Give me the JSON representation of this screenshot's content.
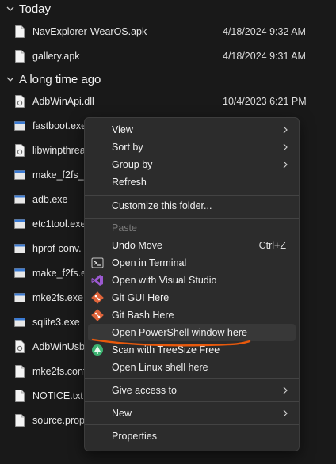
{
  "groups": {
    "today": {
      "title": "Today",
      "files": [
        {
          "name": "NavExplorer-WearOS.apk",
          "date": "4/18/2024 9:32 AM",
          "icon": "document-icon"
        },
        {
          "name": "gallery.apk",
          "date": "4/18/2024 9:31 AM",
          "icon": "document-icon"
        }
      ]
    },
    "long_ago": {
      "title": "A long time ago",
      "files": [
        {
          "name": "AdbWinApi.dll",
          "date": "10/4/2023 6:21 PM",
          "icon": "dll-icon"
        },
        {
          "name": "fastboot.exe",
          "icon": "exe-icon"
        },
        {
          "name": "libwinpthrea",
          "icon": "dll-icon"
        },
        {
          "name": "make_f2fs_c",
          "icon": "exe-icon"
        },
        {
          "name": "adb.exe",
          "icon": "exe-icon"
        },
        {
          "name": "etc1tool.exe",
          "icon": "exe-icon"
        },
        {
          "name": "hprof-conv.",
          "icon": "exe-icon"
        },
        {
          "name": "make_f2fs.e",
          "icon": "exe-icon"
        },
        {
          "name": "mke2fs.exe",
          "icon": "exe-icon"
        },
        {
          "name": "sqlite3.exe",
          "icon": "exe-icon"
        },
        {
          "name": "AdbWinUsb",
          "icon": "dll-icon"
        },
        {
          "name": "mke2fs.conf",
          "icon": "document-icon"
        },
        {
          "name": "NOTICE.txt",
          "icon": "document-icon"
        },
        {
          "name": "source.prop",
          "icon": "document-icon"
        }
      ]
    }
  },
  "context_menu": {
    "view": "View",
    "sort_by": "Sort by",
    "group_by": "Group by",
    "refresh": "Refresh",
    "customize": "Customize this folder...",
    "paste": "Paste",
    "undo_move": "Undo Move",
    "undo_shortcut": "Ctrl+Z",
    "open_terminal": "Open in Terminal",
    "open_vs": "Open with Visual Studio",
    "git_gui": "Git GUI Here",
    "git_bash": "Git Bash Here",
    "open_powershell": "Open PowerShell window here",
    "treesize": "Scan with TreeSize Free",
    "linux_shell": "Open Linux shell here",
    "give_access": "Give access to",
    "new": "New",
    "properties": "Properties"
  },
  "colors": {
    "background": "#191919",
    "menu_bg": "#2c2c2c",
    "annotation_underline": "#e8590c",
    "vs_purple": "#9b59d0",
    "git_orange": "#e0643a",
    "treesize_green": "#3cb371"
  }
}
